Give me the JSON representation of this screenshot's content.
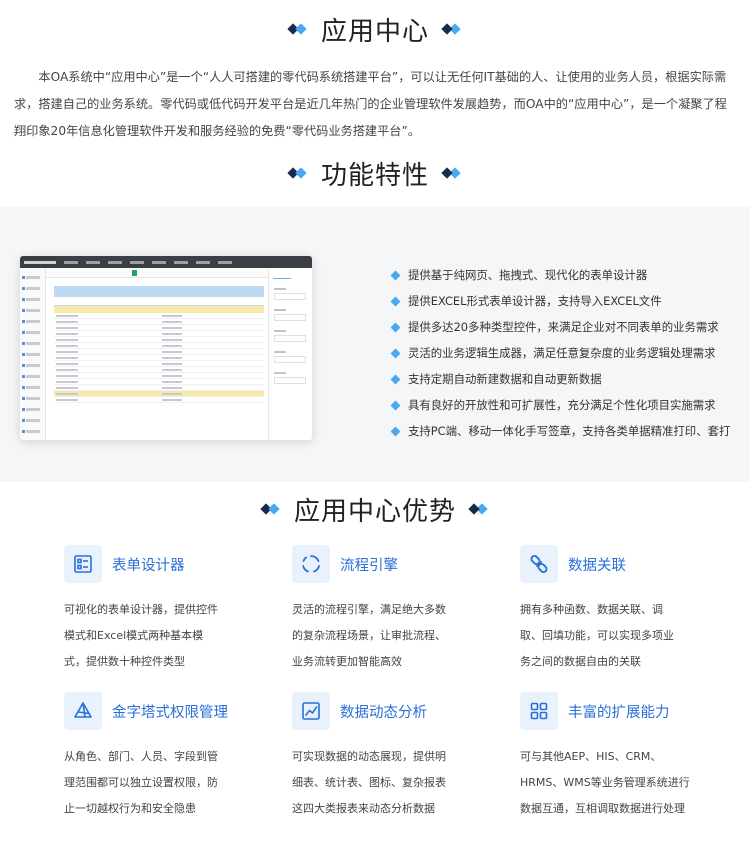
{
  "section1": {
    "title": "应用中心",
    "intro": "本OA系统中“应用中心”是一个“人人可搭建的零代码系统搭建平台”，可以让无任何IT基础的人、让使用的业务人员，根据实际需求，搭建自己的业务系统。零代码或低代码开发平台是近几年热门的企业管理软件发展趋势，而OA中的“应用中心”，是一个凝聚了程翔印象20年信息化管理软件开发和服务经验的免费“零代码业务搭建平台”。"
  },
  "section2": {
    "title": "功能特性",
    "features": [
      "提供基于纯网页、拖拽式、现代化的表单设计器",
      "提供EXCEL形式表单设计器，支持导入EXCEL文件",
      "提供多达20多种类型控件，来满足企业对不同表单的业务需求",
      "灵活的业务逻辑生成器，满足任意复杂度的业务逻辑处理需求",
      "支持定期自动新建数据和自动更新数据",
      "具有良好的开放性和可扩展性，充分满足个性化项目实施需求",
      "支持PC端、移动一体化手写签章，支持各类单据精准打印、套打"
    ]
  },
  "section3": {
    "title": "应用中心优势",
    "cards": [
      {
        "icon": "form-designer-icon",
        "title": "表单设计器",
        "desc": "可视化的表单设计器，提供控件模式和Excel模式两种基本模式，提供数十种控件类型"
      },
      {
        "icon": "flow-engine-icon",
        "title": "流程引擎",
        "desc": "灵活的流程引擎，满足绝大多数的复杂流程场景，让审批流程、业务流转更加智能高效"
      },
      {
        "icon": "data-link-icon",
        "title": "数据关联",
        "desc": "拥有多种函数、数据关联、调取、回填功能，可以实现多项业务之间的数据自由的关联"
      },
      {
        "icon": "pyramid-permission-icon",
        "title": "金字塔式权限管理",
        "desc": "从角色、部门、人员、字段到管理范围都可以独立设置权限，防止一切越权行为和安全隐患"
      },
      {
        "icon": "data-analysis-icon",
        "title": "数据动态分析",
        "desc": "可实现数据的动态展现，提供明细表、统计表、图标、复杂报表这四大类报表来动态分析数据"
      },
      {
        "icon": "extension-icon",
        "title": "丰富的扩展能力",
        "desc": "可与其他AEP、HIS、CRM、HRMS、WMS等业务管理系统进行数据互通，互相调取数据进行处理"
      }
    ]
  },
  "colors": {
    "accent": "#4aa8f0",
    "title_blue": "#2a6fd8",
    "navy": "#1b2a4a",
    "band": "#f5f6f7"
  }
}
